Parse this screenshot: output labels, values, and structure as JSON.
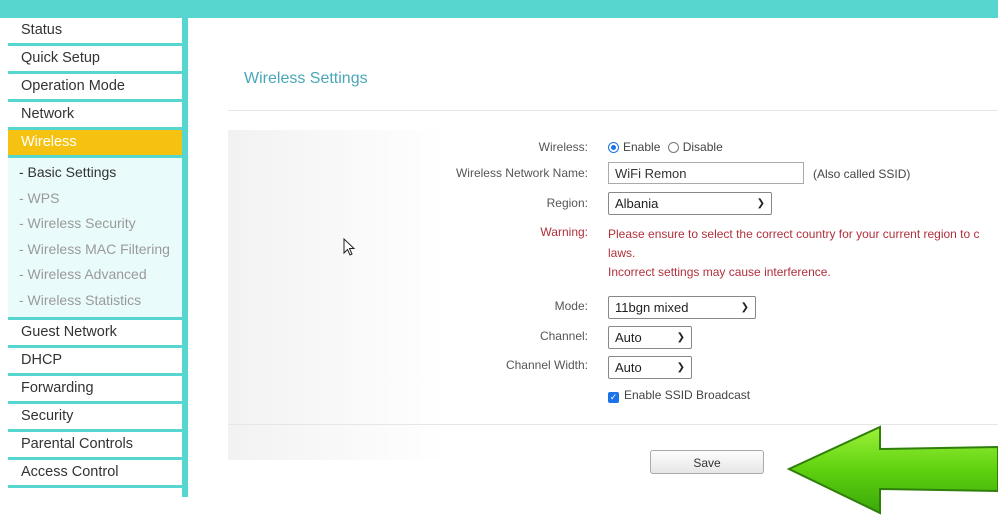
{
  "sidebar": {
    "items_top": [
      {
        "label": "Status"
      },
      {
        "label": "Quick Setup"
      },
      {
        "label": "Operation Mode"
      },
      {
        "label": "Network"
      },
      {
        "label": "Wireless"
      }
    ],
    "subitems": [
      {
        "label": "- Basic Settings"
      },
      {
        "label": "- WPS"
      },
      {
        "label": "- Wireless Security"
      },
      {
        "label": "- Wireless MAC Filtering"
      },
      {
        "label": "- Wireless Advanced"
      },
      {
        "label": "- Wireless Statistics"
      }
    ],
    "items_bottom": [
      {
        "label": "Guest Network"
      },
      {
        "label": "DHCP"
      },
      {
        "label": "Forwarding"
      },
      {
        "label": "Security"
      },
      {
        "label": "Parental Controls"
      },
      {
        "label": "Access Control"
      }
    ]
  },
  "main": {
    "title": "Wireless Settings",
    "wireless_label": "Wireless:",
    "enable_label": "Enable",
    "disable_label": "Disable",
    "ssid_label": "Wireless Network Name:",
    "ssid_value": "WiFi Remon",
    "ssid_hint": "(Also called SSID)",
    "region_label": "Region:",
    "region_value": "Albania",
    "warning_label": "Warning:",
    "warning_line1": "Please ensure to select the correct country for your current region to c",
    "warning_line2": "laws.",
    "warning_line3": "Incorrect settings may cause interference.",
    "mode_label": "Mode:",
    "mode_value": "11bgn mixed",
    "channel_label": "Channel:",
    "channel_value": "Auto",
    "width_label": "Channel Width:",
    "width_value": "Auto",
    "broadcast_label": "Enable SSID Broadcast",
    "save_label": "Save"
  },
  "colors": {
    "accent": "#56d6cf",
    "active_menu": "#f6c212",
    "title": "#4aa6b8",
    "warning": "#b0303c",
    "arrow": "#5fd10f"
  }
}
